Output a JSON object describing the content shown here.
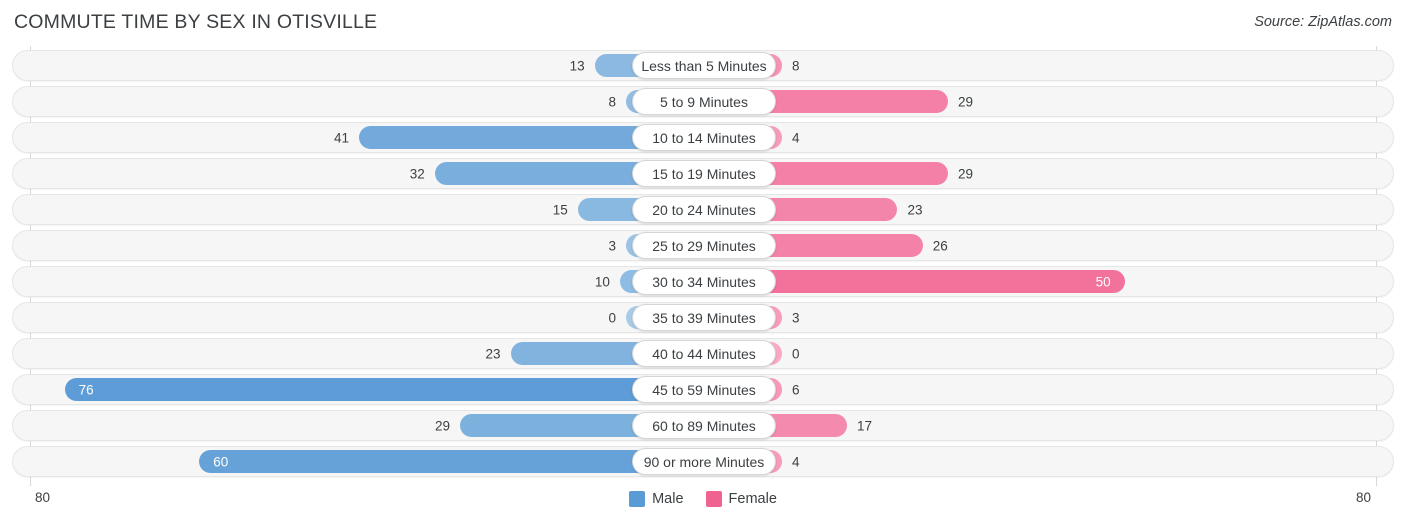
{
  "header": {
    "title": "COMMUTE TIME BY SEX IN OTISVILLE",
    "source": "Source: ZipAtlas.com"
  },
  "footer": {
    "axis_left": "80",
    "axis_right": "80"
  },
  "colors": {
    "male": "#5b9bd5",
    "female": "#f0628f",
    "male_light": "#a8cbe8",
    "female_light": "#f9a8c6",
    "row_track": "#f6f6f6",
    "row_border": "#e6e6e6",
    "axis": "#d8d8d8",
    "text": "#3c4043"
  },
  "chart_data": {
    "type": "bar",
    "subtype": "diverging-bidirectional",
    "title": "COMMUTE TIME BY SEX IN OTISVILLE",
    "xlabel": "",
    "ylabel": "",
    "xlim": [
      80,
      80
    ],
    "axis_max": 80,
    "grid": false,
    "legend_position": "bottom-center",
    "categories": [
      "Less than 5 Minutes",
      "5 to 9 Minutes",
      "10 to 14 Minutes",
      "15 to 19 Minutes",
      "20 to 24 Minutes",
      "25 to 29 Minutes",
      "30 to 34 Minutes",
      "35 to 39 Minutes",
      "40 to 44 Minutes",
      "45 to 59 Minutes",
      "60 to 89 Minutes",
      "90 or more Minutes"
    ],
    "series": [
      {
        "name": "Male",
        "color": "#5b9bd5",
        "direction": "left",
        "values": [
          13,
          8,
          41,
          32,
          15,
          3,
          10,
          0,
          23,
          76,
          29,
          60
        ]
      },
      {
        "name": "Female",
        "color": "#f0628f",
        "direction": "right",
        "values": [
          8,
          29,
          4,
          29,
          23,
          26,
          50,
          3,
          0,
          6,
          17,
          4
        ]
      }
    ]
  },
  "legend": {
    "items": [
      {
        "label": "Male",
        "color": "#5b9bd5"
      },
      {
        "label": "Female",
        "color": "#f0628f"
      }
    ]
  }
}
